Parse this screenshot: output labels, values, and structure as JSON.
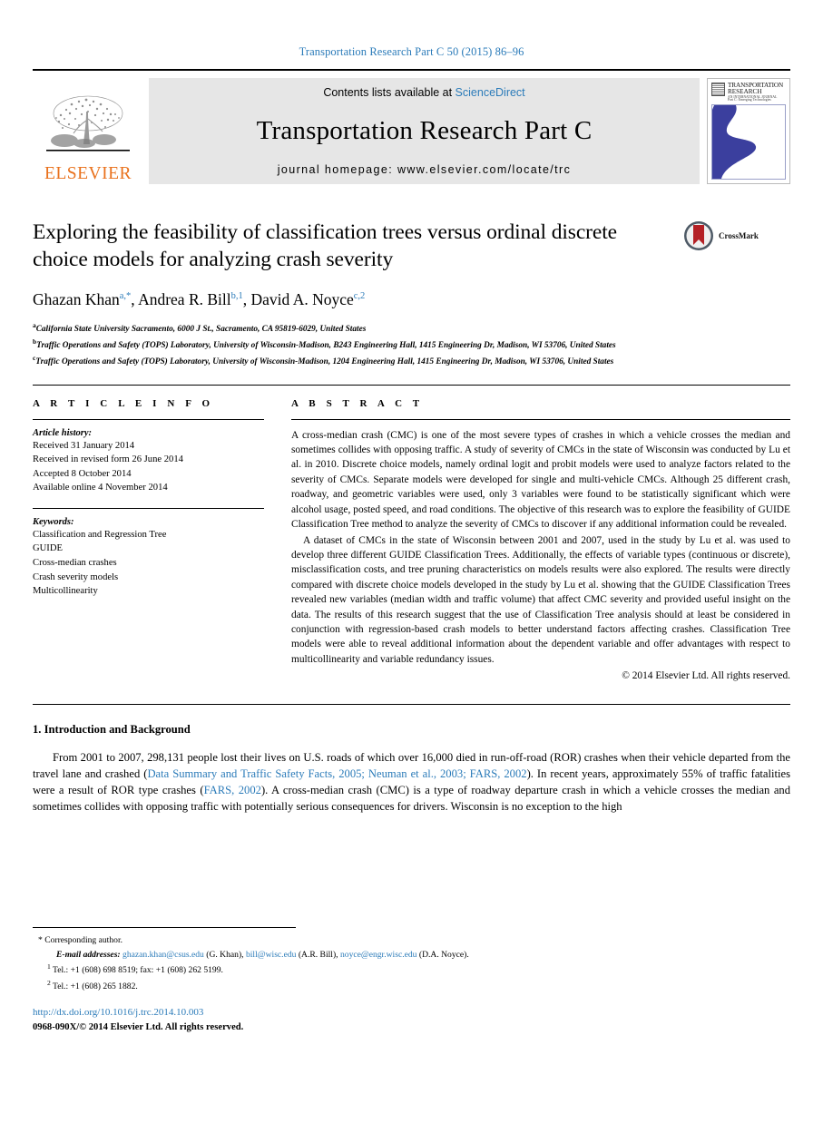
{
  "running_head": "Transportation Research Part C 50 (2015) 86–96",
  "masthead": {
    "contents_prefix": "Contents lists available at ",
    "sciencedirect": "ScienceDirect",
    "journal_title": "Transportation Research Part C",
    "homepage": "journal homepage: www.elsevier.com/locate/trc",
    "publisher": "ELSEVIER",
    "cover": {
      "line1": "TRANSPORTATION",
      "line2": "RESEARCH",
      "line3": "AN INTERNATIONAL JOURNAL",
      "line4": "Part C: Emerging Technologies"
    }
  },
  "article": {
    "title": "Exploring the feasibility of classification trees versus ordinal discrete choice models for analyzing crash severity",
    "crossmark_label": "CrossMark",
    "authors": [
      {
        "name": "Ghazan Khan",
        "marks": "a,*"
      },
      {
        "name": "Andrea R. Bill",
        "marks": "b,1"
      },
      {
        "name": "David A. Noyce",
        "marks": "c,2"
      }
    ],
    "affiliations": [
      {
        "mark": "a",
        "text": "California State University Sacramento, 6000 J St., Sacramento, CA 95819-6029, United States"
      },
      {
        "mark": "b",
        "text": "Traffic Operations and Safety (TOPS) Laboratory, University of Wisconsin-Madison, B243 Engineering Hall, 1415 Engineering Dr, Madison, WI 53706, United States"
      },
      {
        "mark": "c",
        "text": "Traffic Operations and Safety (TOPS) Laboratory, University of Wisconsin-Madison, 1204 Engineering Hall, 1415 Engineering Dr, Madison, WI 53706, United States"
      }
    ]
  },
  "article_info": {
    "heading": "A R T I C L E  I N F O",
    "history_label": "Article history:",
    "history": [
      "Received 31 January 2014",
      "Received in revised form 26 June 2014",
      "Accepted 8 October 2014",
      "Available online 4 November 2014"
    ],
    "keywords_label": "Keywords:",
    "keywords": [
      "Classification and Regression Tree",
      "GUIDE",
      "Cross-median crashes",
      "Crash severity models",
      "Multicollinearity"
    ]
  },
  "abstract": {
    "heading": "A B S T R A C T",
    "paragraph1": "A cross-median crash (CMC) is one of the most severe types of crashes in which a vehicle crosses the median and sometimes collides with opposing traffic. A study of severity of CMCs in the state of Wisconsin was conducted by Lu et al. in 2010. Discrete choice models, namely ordinal logit and probit models were used to analyze factors related to the severity of CMCs. Separate models were developed for single and multi-vehicle CMCs. Although 25 different crash, roadway, and geometric variables were used, only 3 variables were found to be statistically significant which were alcohol usage, posted speed, and road conditions. The objective of this research was to explore the feasibility of GUIDE Classification Tree method to analyze the severity of CMCs to discover if any additional information could be revealed.",
    "paragraph2": "A dataset of CMCs in the state of Wisconsin between 2001 and 2007, used in the study by Lu et al. was used to develop three different GUIDE Classification Trees. Additionally, the effects of variable types (continuous or discrete), misclassification costs, and tree pruning characteristics on models results were also explored. The results were directly compared with discrete choice models developed in the study by Lu et al. showing that the GUIDE Classification Trees revealed new variables (median width and traffic volume) that affect CMC severity and provided useful insight on the data. The results of this research suggest that the use of Classification Tree analysis should at least be considered in conjunction with regression-based crash models to better understand factors affecting crashes. Classification Tree models were able to reveal additional information about the dependent variable and offer advantages with respect to multicollinearity and variable redundancy issues.",
    "copyright": "© 2014 Elsevier Ltd. All rights reserved."
  },
  "introduction": {
    "heading": "1. Introduction and Background",
    "para_part1": "From 2001 to 2007, 298,131 people lost their lives on U.S. roads of which over 16,000 died in run-off-road (ROR) crashes when their vehicle departed from the travel lane and crashed (",
    "ref1": "Data Summary and Traffic Safety Facts, 2005; Neuman et al., 2003; FARS, 2002",
    "para_part2": "). In recent years, approximately 55% of traffic fatalities were a result of ROR type crashes (",
    "ref2": "FARS, 2002",
    "para_part3": "). A cross-median crash (CMC) is a type of roadway departure crash in which a vehicle crosses the median and sometimes collides with opposing traffic with potentially serious consequences for drivers. Wisconsin is no exception to the high"
  },
  "footnotes": {
    "corresponding": "Corresponding author.",
    "email_label": "E-mail addresses:",
    "emails": [
      {
        "address": "ghazan.khan@csus.edu",
        "person": "(G. Khan),"
      },
      {
        "address": "bill@wisc.edu",
        "person": "(A.R. Bill),"
      },
      {
        "address": "noyce@engr.wisc.edu",
        "person": "(D.A. Noyce)."
      }
    ],
    "note1_mark": "1",
    "note1": "Tel.: +1 (608) 698 8519; fax: +1 (608) 262 5199.",
    "note2_mark": "2",
    "note2": "Tel.: +1 (608) 265 1882.",
    "doi": "http://dx.doi.org/10.1016/j.trc.2014.10.003",
    "issn": "0968-090X/© 2014 Elsevier Ltd. All rights reserved."
  },
  "colors": {
    "link": "#2b7bb9",
    "elsevier_orange": "#E9711C",
    "cover_blue": "#3b3f9e",
    "masthead_gray": "#e6e6e6"
  }
}
